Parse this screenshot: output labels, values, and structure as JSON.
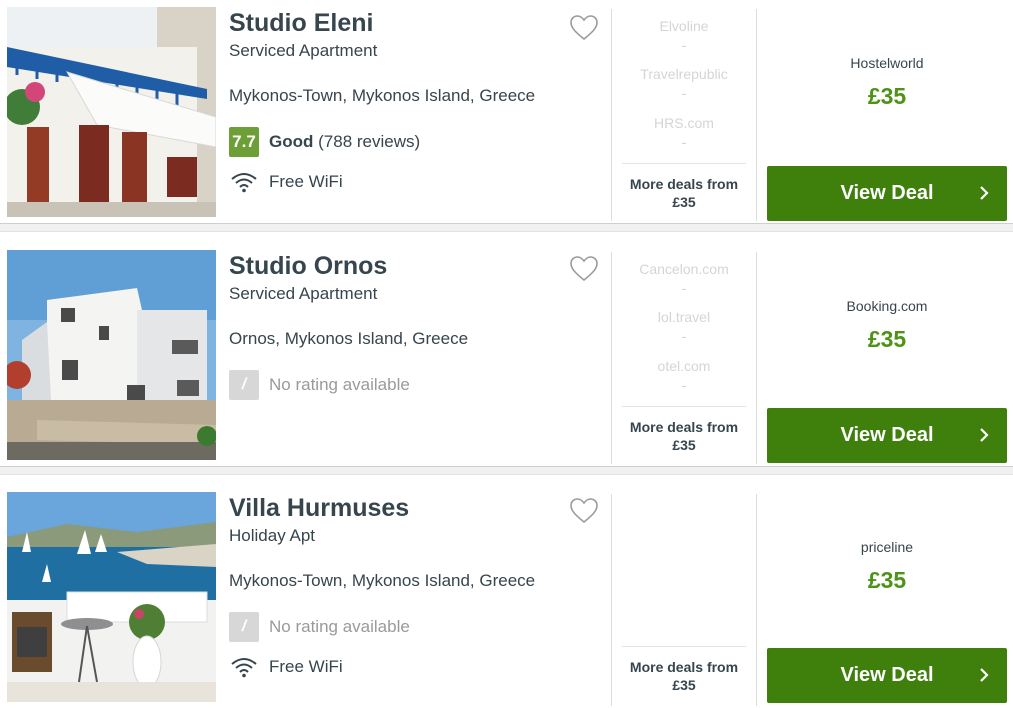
{
  "hotels": [
    {
      "name": "Studio Eleni",
      "type": "Serviced Apartment",
      "location": "Mykonos-Town, Mykonos Island, Greece",
      "rating": {
        "score": "7.7",
        "word": "Good",
        "reviews": "(788 reviews)"
      },
      "amenity": "Free WiFi",
      "other_deals": [
        {
          "site": "Elvoline",
          "price": "-"
        },
        {
          "site": "Travelrepublic",
          "price": "-"
        },
        {
          "site": "HRS.com",
          "price": "-"
        }
      ],
      "more_deals": "More deals from £35",
      "provider": "Hostelworld",
      "price": "£35",
      "cta": "View Deal"
    },
    {
      "name": "Studio Ornos",
      "type": "Serviced Apartment",
      "location": "Ornos, Mykonos Island, Greece",
      "rating": {
        "score": "/",
        "text": "No rating available"
      },
      "other_deals": [
        {
          "site": "Cancelon.com",
          "price": "-"
        },
        {
          "site": "lol.travel",
          "price": "-"
        },
        {
          "site": "otel.com",
          "price": "-"
        }
      ],
      "more_deals": "More deals from £35",
      "provider": "Booking.com",
      "price": "£35",
      "cta": "View Deal"
    },
    {
      "name": "Villa Hurmuses",
      "type": "Holiday Apt",
      "location": "Mykonos-Town, Mykonos Island, Greece",
      "rating": {
        "score": "/",
        "text": "No rating available"
      },
      "amenity": "Free WiFi",
      "other_deals": [],
      "more_deals": "More deals from £35",
      "provider": "priceline",
      "price": "£35",
      "cta": "View Deal"
    }
  ],
  "colors": {
    "rating_green": "#6d9f37",
    "price_green": "#4d9318",
    "cta_green": "#3f7f0c",
    "text_dark": "#37454d",
    "muted": "#9a9a9a"
  },
  "icons": [
    "heart-icon",
    "wifi-icon",
    "chevron-right-icon"
  ]
}
